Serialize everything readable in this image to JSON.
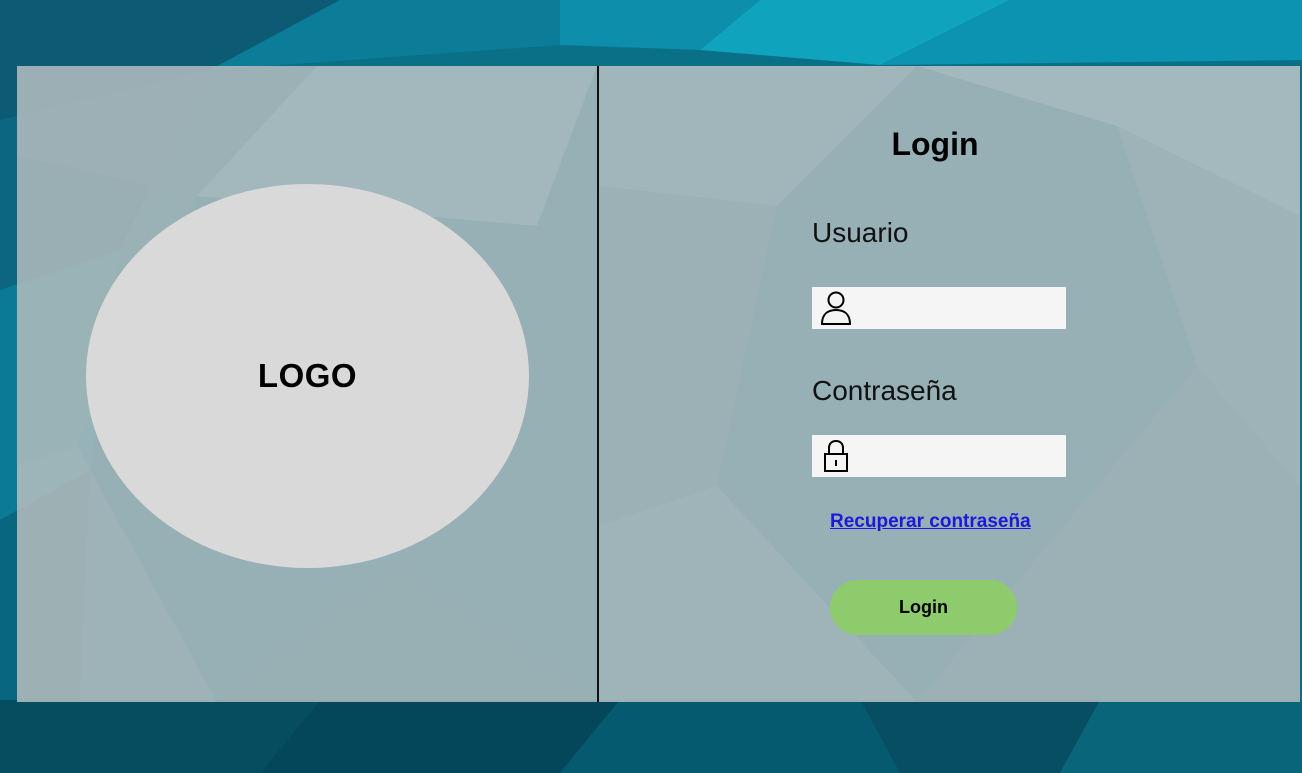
{
  "colors": {
    "background": "#0a6f86",
    "card": "#bec3c3",
    "logo_circle": "#d9d9d9",
    "input_bg": "#f5f5f5",
    "link": "#1a1ad8",
    "button": "#8dcb6d"
  },
  "logo": {
    "text": "LOGO"
  },
  "login": {
    "title": "Login",
    "user_label": "Usuario",
    "user_icon": "user-icon",
    "user_value": "",
    "password_label": "Contraseña",
    "password_icon": "lock-icon",
    "password_value": "",
    "recover_link": "Recuperar contraseña",
    "button_label": "Login"
  }
}
